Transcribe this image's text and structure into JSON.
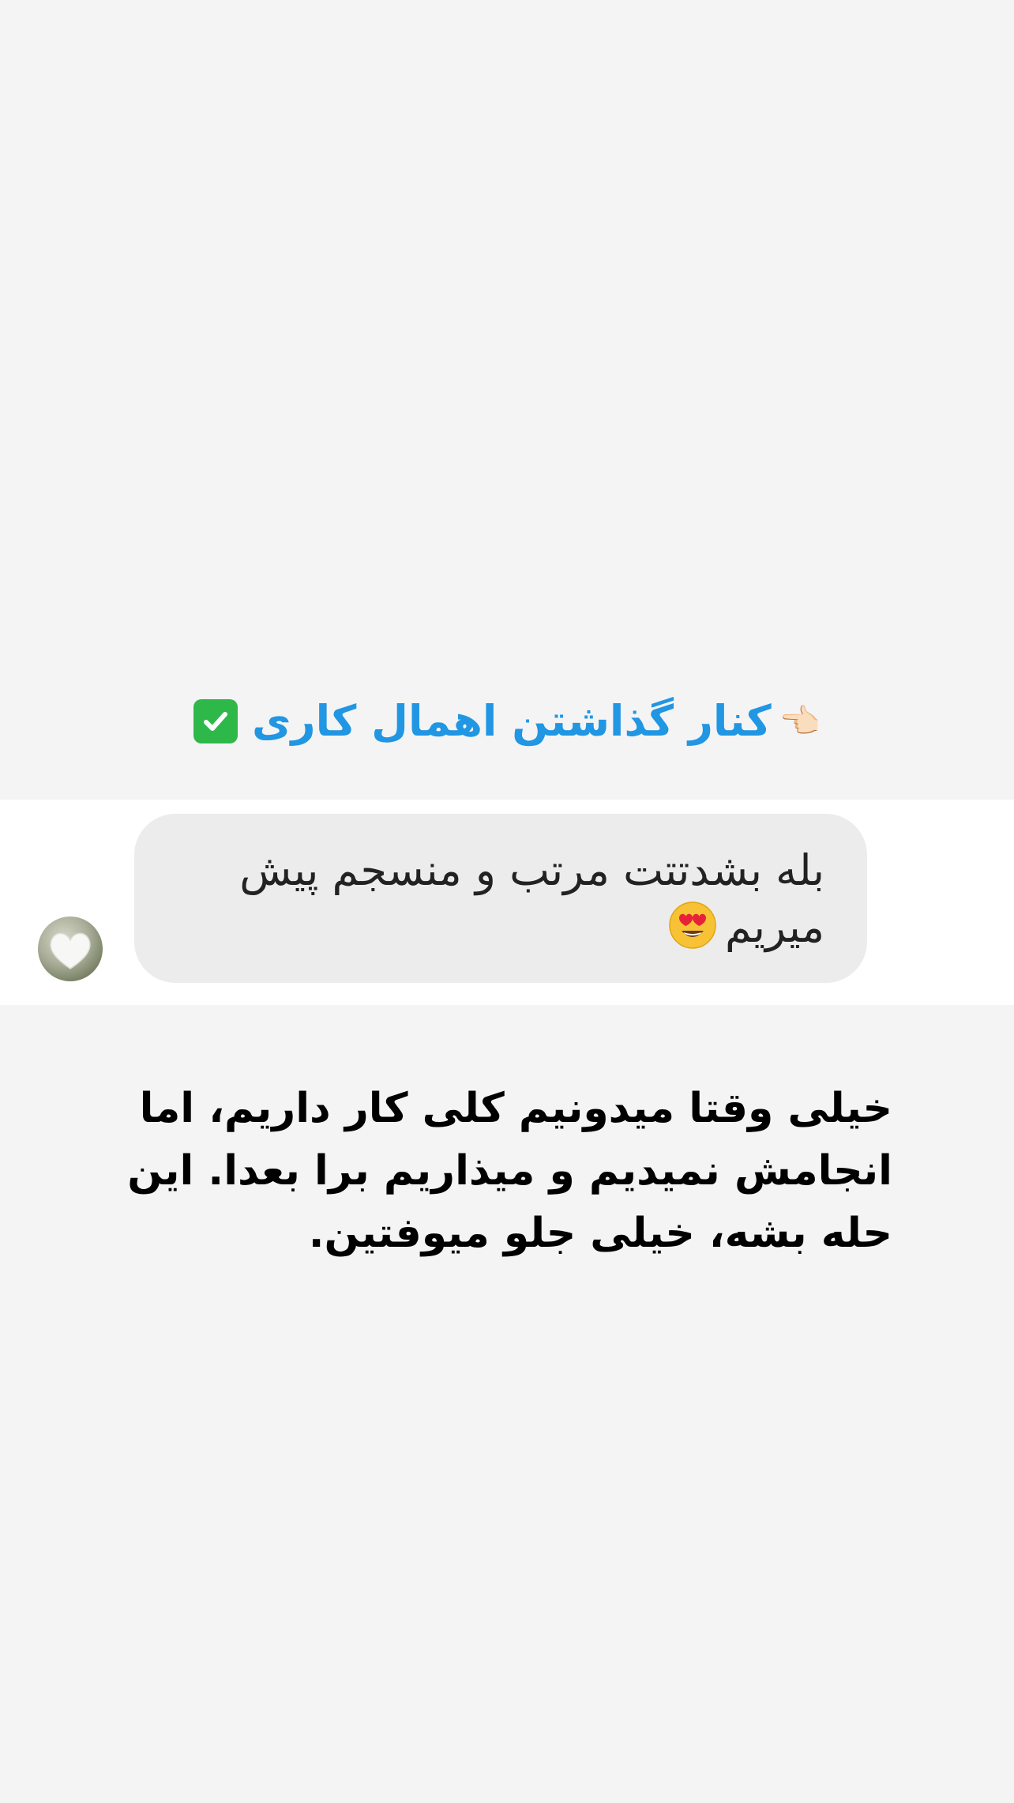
{
  "headline": {
    "text": "کنار گذاشتن اهمال کاری",
    "pointing_hand_emoji": "👈🏻",
    "check_icon": "check-mark-button-icon",
    "text_color": "#2196e3",
    "check_color": "#2fb84a"
  },
  "message": {
    "text_line1": "بله بشدتتت مرتب و منسجم پیش",
    "text_line2": "میریم",
    "emoji_icon": "heart-eyes-face-icon",
    "bubble_color": "#ececec"
  },
  "avatar": {
    "icon": "profile-photo"
  },
  "body": {
    "paragraph": "خیلی وقتا میدونیم کلی کار داریم، اما انجامش نمیدیم و میذاریم برا بعدا. این حله بشه، خیلی جلو میوفتین."
  },
  "colors": {
    "background": "#f4f4f4",
    "chat_strip": "#ffffff"
  }
}
